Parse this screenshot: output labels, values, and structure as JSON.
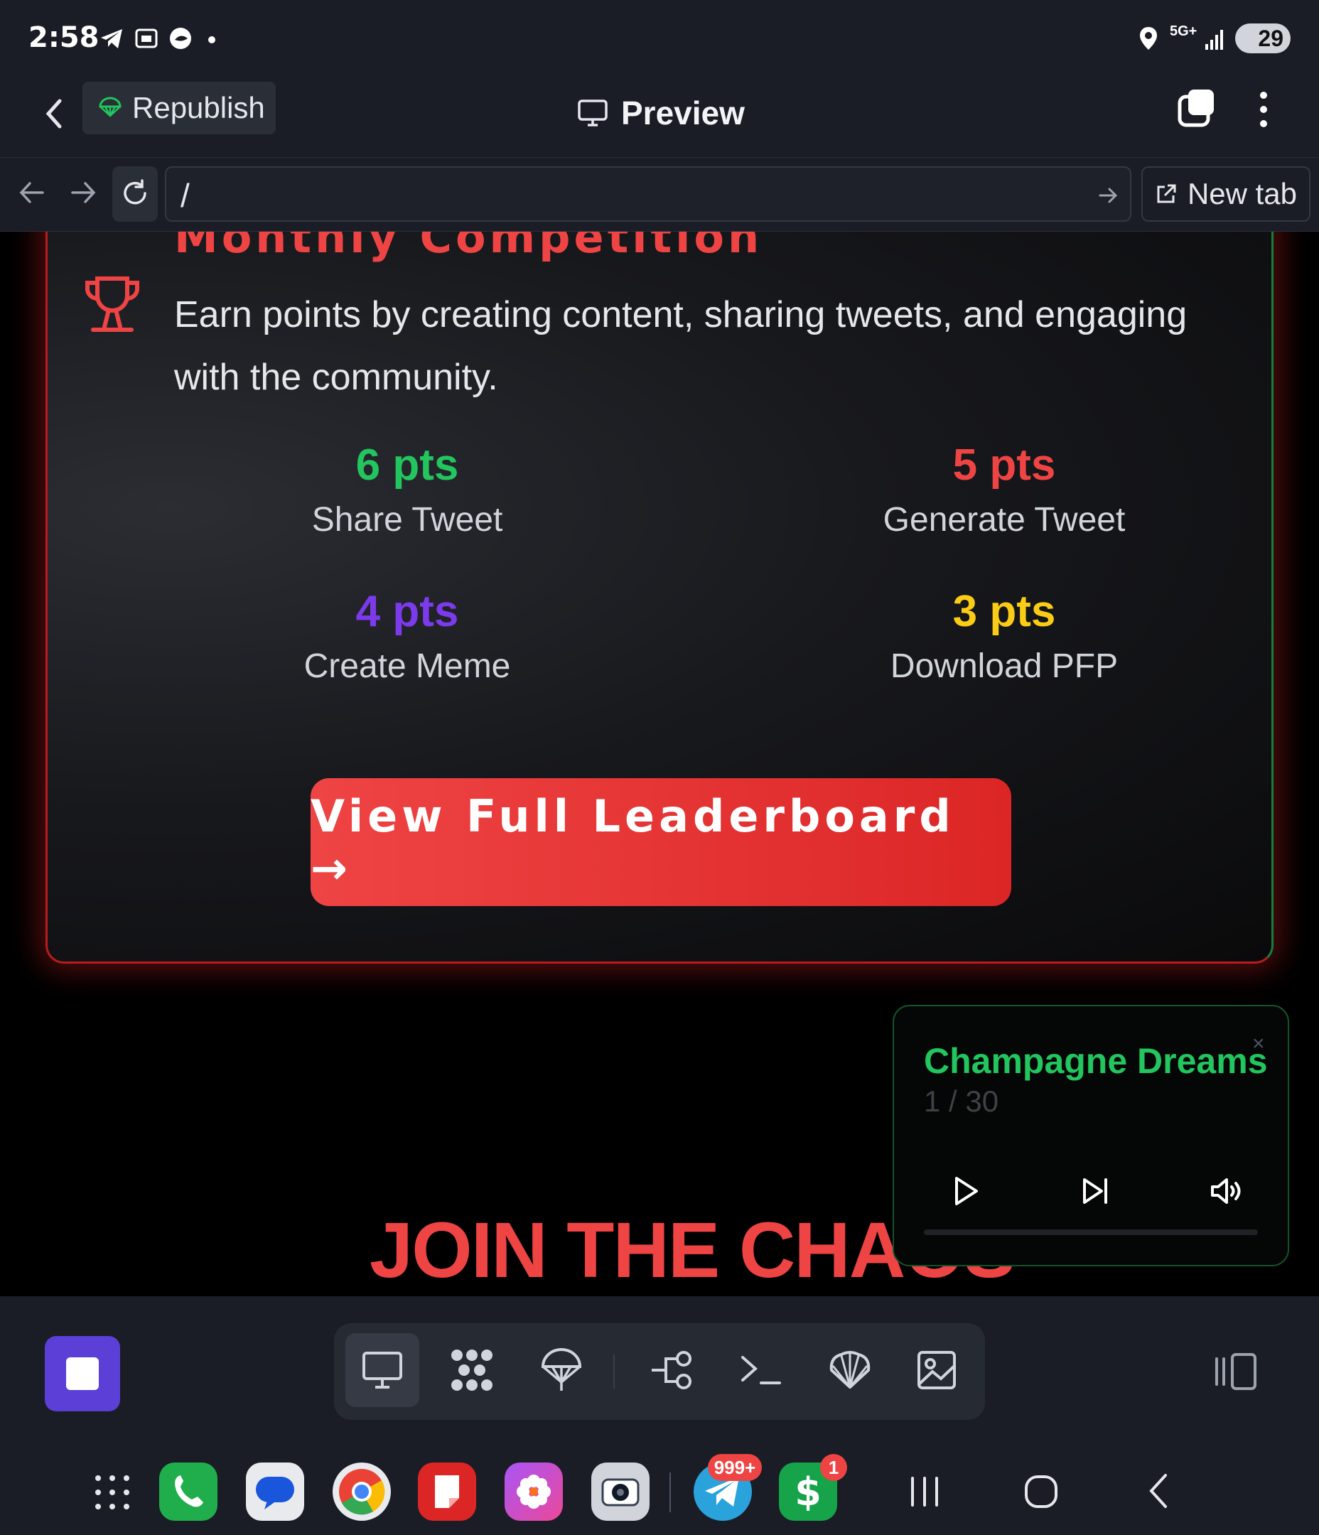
{
  "status_bar": {
    "time": "2:58",
    "network": "5G+",
    "battery": "29"
  },
  "app_bar": {
    "republish_label": "Republish",
    "preview_label": "Preview"
  },
  "url_bar": {
    "url": "/",
    "new_tab_label": "New tab"
  },
  "competition": {
    "title": "Monthly Competition",
    "description": "Earn points by creating content, sharing tweets, and engaging with the community.",
    "items": [
      {
        "points": "6 pts",
        "label": "Share Tweet",
        "color": "#22c55e"
      },
      {
        "points": "5 pts",
        "label": "Generate Tweet",
        "color": "#ef4444"
      },
      {
        "points": "4 pts",
        "label": "Create Meme",
        "color": "#7c3aed"
      },
      {
        "points": "3 pts",
        "label": "Download PFP",
        "color": "#facc15"
      }
    ],
    "button_label": "View Full Leaderboard →"
  },
  "join_heading": "JOIN THE CHAOS",
  "player": {
    "track_title": "Champagne Dreams",
    "track_counter": "1 / 30",
    "close_label": "×",
    "progress": 0
  },
  "dock": {
    "tools": [
      "desktop-icon",
      "apps-grid-icon",
      "parachute-icon",
      "workflow-icon",
      "terminal-icon",
      "shell-icon",
      "image-icon"
    ]
  },
  "nav": {
    "telegram_badge": "999+",
    "cash_badge": "1"
  },
  "colors": {
    "accent_red": "#ef4444",
    "accent_green": "#22c55e",
    "stop_button": "#5b3fd6"
  }
}
